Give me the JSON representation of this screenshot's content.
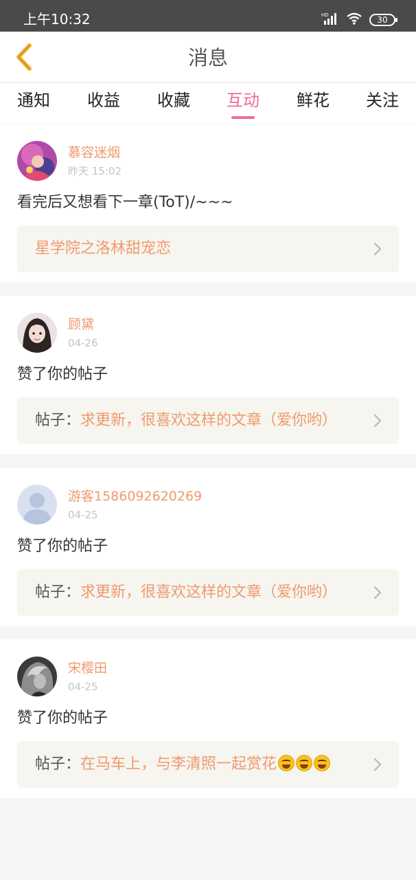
{
  "status_bar": {
    "time": "上午10:32",
    "battery": "30",
    "hd": "HD"
  },
  "header": {
    "title": "消息"
  },
  "tabs": [
    {
      "label": "通知"
    },
    {
      "label": "收益"
    },
    {
      "label": "收藏"
    },
    {
      "label": "互动",
      "active": true
    },
    {
      "label": "鲜花"
    },
    {
      "label": "关注"
    }
  ],
  "messages": [
    {
      "name": "慕容迷烟",
      "time": "昨天 15:02",
      "text": "看完后又想看下一章(ToT)/~~~",
      "ref_prefix": "",
      "ref_title": "星学院之洛林甜宠恋"
    },
    {
      "name": "顾黛",
      "time": "04-26",
      "text": "赞了你的帖子",
      "ref_prefix": "帖子：",
      "ref_title": "求更新，很喜欢这样的文章（爱你哟）"
    },
    {
      "name": "游客1586092620269",
      "time": "04-25",
      "text": "赞了你的帖子",
      "ref_prefix": "帖子：",
      "ref_title": "求更新，很喜欢这样的文章（爱你哟）"
    },
    {
      "name": "宋樱田",
      "time": "04-25",
      "text": "赞了你的帖子",
      "ref_prefix": "帖子：",
      "ref_title": "在马车上，与李清照一起赏花"
    }
  ],
  "icons": {
    "back": "chevron-left-icon",
    "ref_arrow": "chevron-right-icon",
    "emoji": "rolling-laughing-emoji"
  },
  "colors": {
    "accent": "#ec6b9e",
    "name": "#ef9a6e",
    "back_icon": "#f1b02c",
    "ref_bg": "#f6f5ef"
  }
}
